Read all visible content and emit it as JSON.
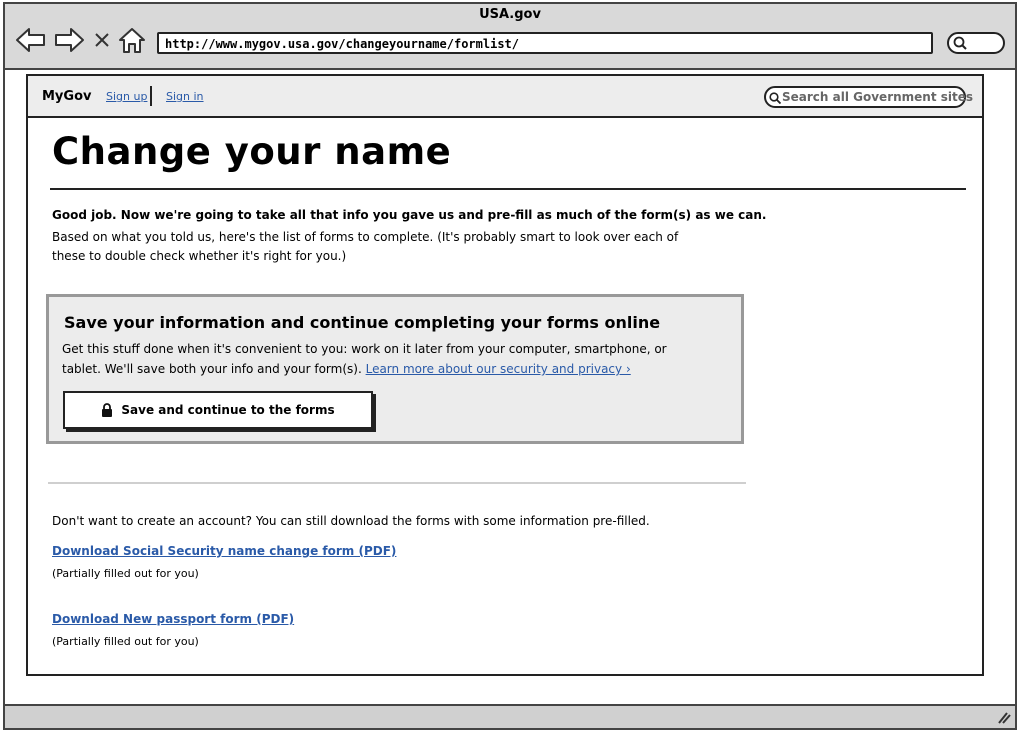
{
  "browser": {
    "window_title": "USA.gov",
    "url": "http://www.mygov.usa.gov/changeyourname/formlist/"
  },
  "nav": {
    "brand": "MyGov",
    "sign_up": "Sign up",
    "sign_in": "Sign in",
    "search_placeholder": "Search all Government sites"
  },
  "page": {
    "title": "Change your name",
    "intro_bold": "Good job. Now we're going to take all that info you gave us and pre-fill as much of the form(s) as we can.",
    "intro_text": "Based on what you told us, here's the list of forms to complete. (It's probably smart to look over each of these to double check whether it's right for you.)"
  },
  "save_box": {
    "heading": "Save your information and continue completing your forms online",
    "text": "Get this stuff done when it's convenient to you: work on it later from your computer, smartphone, or tablet. We'll save both your info and your form(s).",
    "link": "Learn more about our security and privacy ›",
    "button_label": "Save and continue to the forms"
  },
  "downloads": {
    "intro": "Don't want to create an account? You can still download the forms with some information pre-filled.",
    "items": [
      {
        "label": "Download Social Security name change form (PDF)",
        "note": "(Partially filled out for you)"
      },
      {
        "label": "Download New passport form (PDF)",
        "note": "(Partially filled out for you)"
      }
    ]
  }
}
